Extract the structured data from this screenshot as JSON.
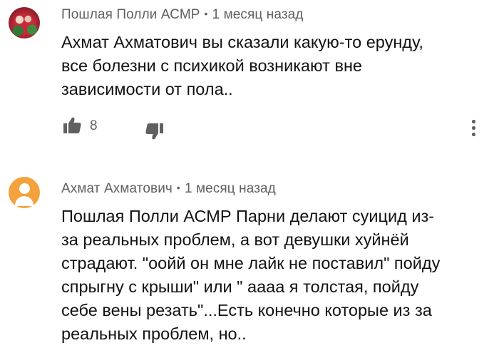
{
  "comments": [
    {
      "author": "Пошлая Полли АСМР",
      "separator": "•",
      "time": "1 месяц назад",
      "avatar": "photo-avatar",
      "text_lines": [
        "Ахмат Ахматович вы сказали какую-то ерунду,",
        "все болезни с психикой возникают вне",
        "зависимости от пола.."
      ],
      "likes": "8",
      "icons": {
        "like": "thumb-up-icon",
        "dislike": "thumb-down-icon",
        "more": "more-vert-icon"
      }
    },
    {
      "author": "Ахмат Ахматович",
      "separator": "•",
      "time": "1 месяц назад",
      "avatar": "default-user-avatar",
      "avatar_color": "#f4a23d",
      "text_lines": [
        "Пошлая Полли АСМР Парни делают суицид из-",
        "за реальных проблем, а вот девушки хуйнёй",
        "страдают. \"оойй он мне лайк не поставил\" пойду",
        "спрыгну с крыши\" или \" аааа я толстая, пойду",
        "себе вены резать\"...Есть конечно которые из за",
        "реальных проблем, но.."
      ]
    }
  ],
  "colors": {
    "meta_text": "#606060",
    "body_text": "#121212",
    "icon": "#606060"
  }
}
